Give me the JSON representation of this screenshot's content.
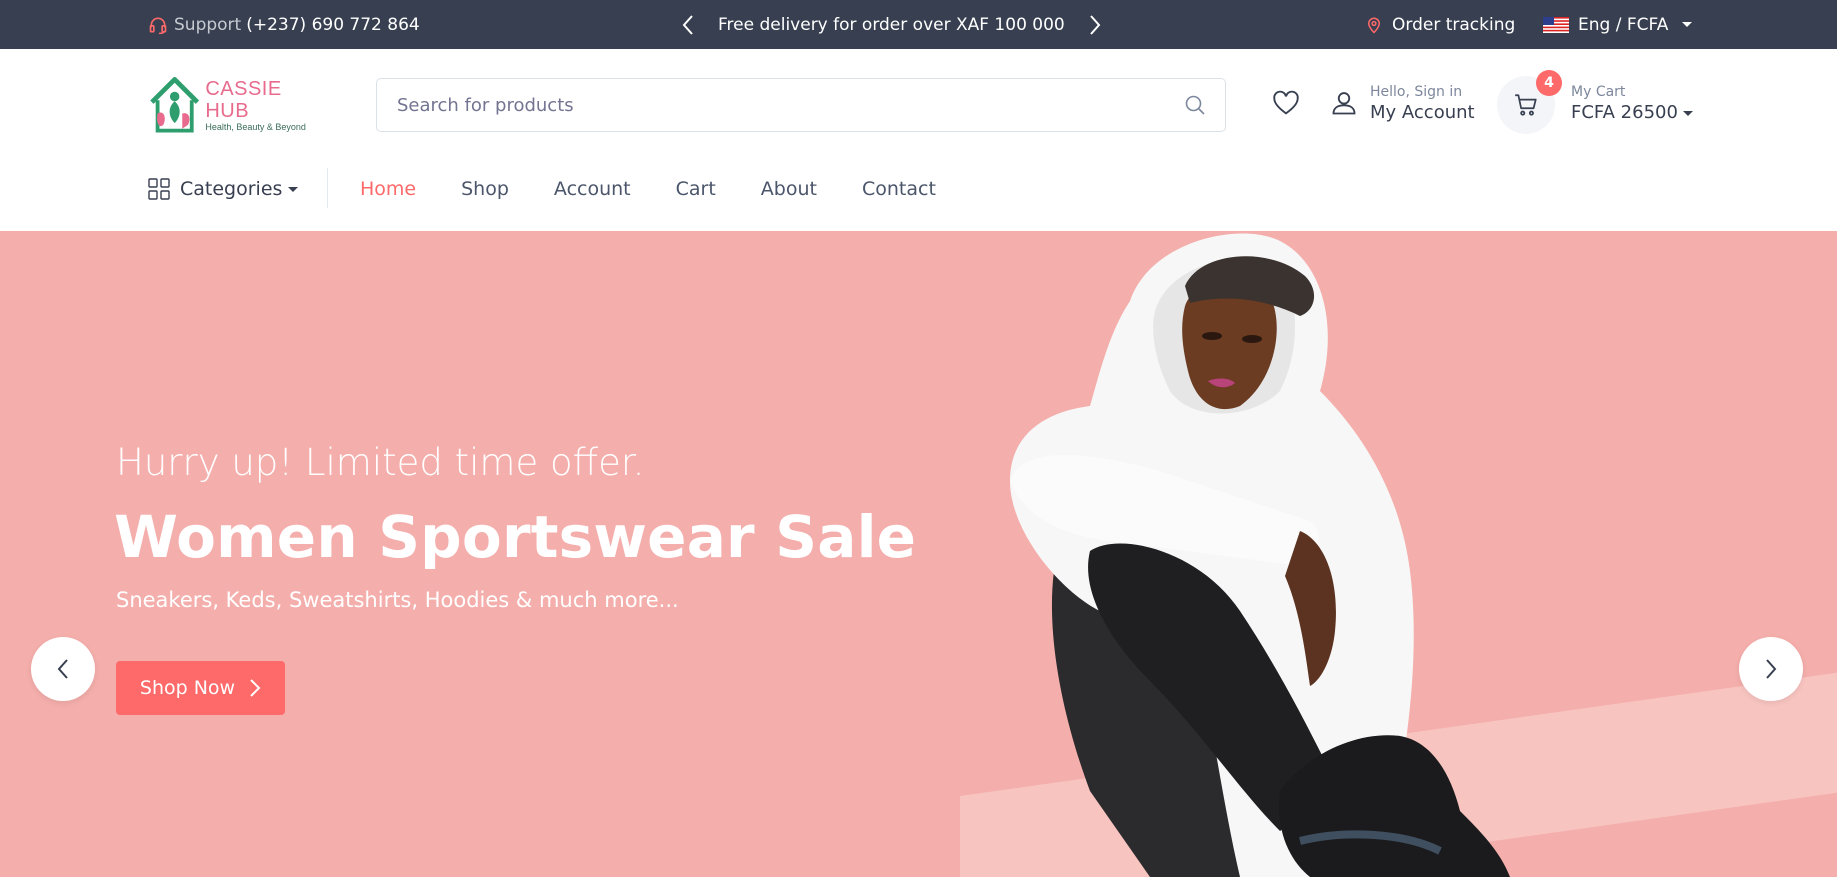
{
  "colors": {
    "topbar_bg": "#373f50",
    "accent": "#fe696a",
    "hero_bg": "#f4aeab",
    "brand_pink": "#e86b8d",
    "brand_green": "#2e9e6e"
  },
  "topbar": {
    "support_label": "Support",
    "support_phone": "(+237) 690 772 864",
    "promo_text": "Free delivery for order over XAF 100 000",
    "order_tracking": "Order tracking",
    "language_currency": "Eng / FCFA"
  },
  "header": {
    "brand_name": "CASSIE HUB",
    "brand_tagline": "Health, Beauty & Beyond",
    "search_placeholder": "Search for products",
    "account_greeting": "Hello, Sign in",
    "account_label": "My Account",
    "cart_count": "4",
    "cart_label": "My Cart",
    "cart_total": "FCFA 26500"
  },
  "nav": {
    "categories_label": "Categories",
    "items": [
      {
        "label": "Home",
        "active": true
      },
      {
        "label": "Shop"
      },
      {
        "label": "Account"
      },
      {
        "label": "Cart"
      },
      {
        "label": "About"
      },
      {
        "label": "Contact"
      }
    ]
  },
  "hero": {
    "subtitle": "Hurry up! Limited time offer.",
    "title": "Women Sportswear Sale",
    "description": "Sneakers, Keds, Sweatshirts, Hoodies & much more...",
    "button_label": "Shop Now"
  },
  "icons": [
    "headset-icon",
    "chevron-left-icon",
    "chevron-right-icon",
    "map-pin-icon",
    "us-flag-icon",
    "search-icon",
    "heart-icon",
    "user-icon",
    "cart-icon",
    "grid-icon"
  ]
}
